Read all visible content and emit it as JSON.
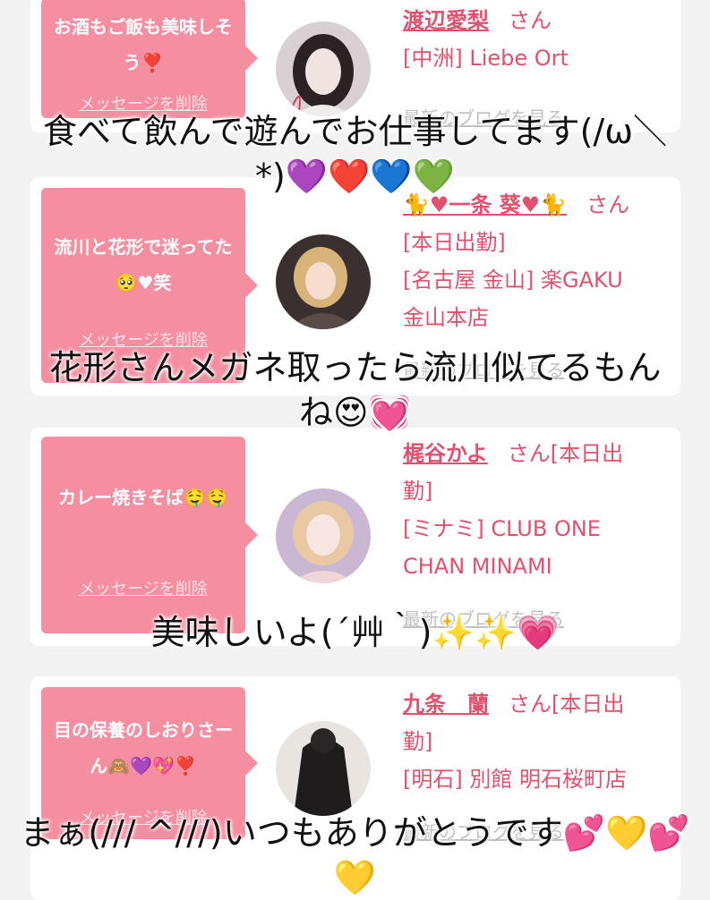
{
  "cards": [
    {
      "bubble": "お酒もご飯も美味しそう❣️",
      "delete": "メッセージを削除",
      "name": "渡辺愛梨",
      "honorific": "さん",
      "lines": [
        "[中洲] Liebe Ort"
      ],
      "blog": "最新のブログを見る",
      "avatar": "avatar-photo"
    },
    {
      "bubble": "流川と花形で迷ってた🥺♥︎笑",
      "delete": "メッセージを削除",
      "name": "🐈♥一条 葵♥🐈",
      "honorific": "さん",
      "lines": [
        "[本日出勤]",
        "[名古屋 金山] 楽GAKU",
        "金山本店"
      ],
      "blog": "最新のブログを見る",
      "avatar": "avatar-photo"
    },
    {
      "bubble": "カレー焼きそば🤤🤤",
      "delete": "メッセージを削除",
      "name": "梶谷かよ",
      "honorific": "さん[本日出",
      "lines": [
        "勤]",
        "[ミナミ] CLUB ONE",
        "CHAN MINAMI"
      ],
      "blog": "最新のブログを見る",
      "avatar": "avatar-photo"
    },
    {
      "bubble": "目の保養のしおりさーん🙈💜💖❣️",
      "delete": "メッセージを削除",
      "name": "九条　蘭",
      "honorific": "さん[本日出",
      "lines": [
        "勤]",
        "[明石] 別館 明石桜町店"
      ],
      "blog": "最新のブログを見る",
      "avatar": "avatar-photo"
    }
  ],
  "overlays": [
    {
      "line1": "食べて飲んで遊んでお仕事してます(/ω＼",
      "line2": "*)💜❤️💙💚"
    },
    {
      "line1": "花形さんメガネ取ったら流川似てるもん",
      "line2": "ね😍💓"
    },
    {
      "line1": "美味しいよ(´艸｀)✨✨💗",
      "line2": ""
    },
    {
      "line1": "まぁ(/// ^///)いつもありがとうです💕💛💕",
      "line2": "💛"
    }
  ],
  "colors": {
    "accent": "#e2506e",
    "bubble": "#f58ea0"
  }
}
